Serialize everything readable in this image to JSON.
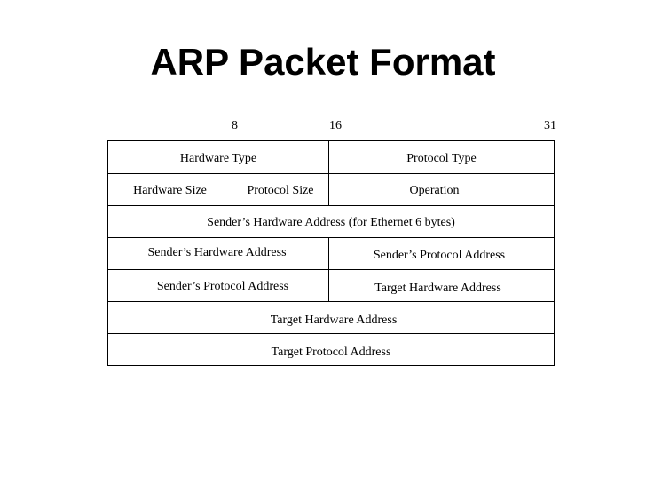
{
  "title": "ARP Packet Format",
  "bit_markers": {
    "b8": "8",
    "b16": "16",
    "b31": "31"
  },
  "fields": {
    "hardware_type": "Hardware Type",
    "protocol_type": "Protocol Type",
    "hardware_size": "Hardware Size",
    "protocol_size": "Protocol Size",
    "operation": "Operation",
    "sender_hw_full": "Sender’s Hardware Address (for Ethernet 6 bytes)",
    "sender_hw": "Sender’s Hardware Address",
    "sender_proto_right": "Sender’s Protocol Address",
    "sender_proto_left": "Sender’s Protocol Address",
    "target_hw_right": "Target Hardware Address",
    "target_hw_full": "Target Hardware Address",
    "target_proto": "Target Protocol Address"
  }
}
